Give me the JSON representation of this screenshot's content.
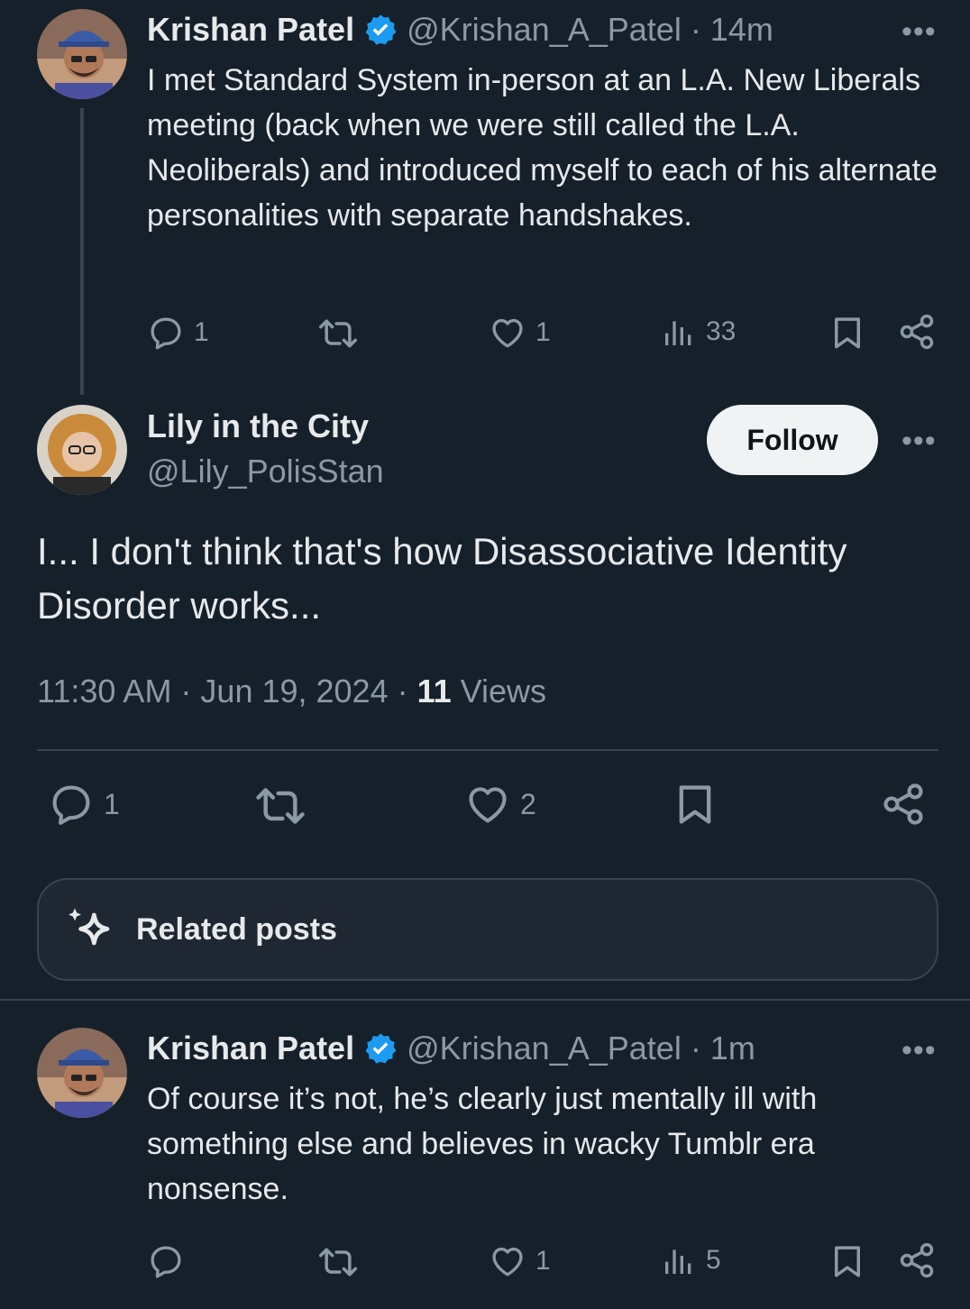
{
  "tweet1": {
    "name": "Krishan Patel",
    "handle": "@Krishan_A_Patel",
    "time": "· 14m",
    "text": "I met Standard System in-person at an L.A. New Liberals meeting (back when we were still called the L.A. Neoliberals) and introduced myself to each of his alternate personalities with separate handshakes.",
    "replies": "1",
    "likes": "1",
    "views": "33"
  },
  "main": {
    "name": "Lily in the City",
    "handle": "@Lily_PolisStan",
    "follow_label": "Follow",
    "text": "I... I don't think that's how Disassociative Identity Disorder works...",
    "timestamp": "11:30 AM · Jun 19, 2024 · ",
    "views_count": "11",
    "views_label": "Views",
    "replies": "1",
    "likes": "2"
  },
  "related": {
    "label": "Related posts"
  },
  "tweet2": {
    "name": "Krishan Patel",
    "handle": "@Krishan_A_Patel",
    "time": "· 1m",
    "text": "Of course it’s not, he’s clearly just mentally ill with something else and believes in wacky Tumblr era nonsense.",
    "likes": "1",
    "views": "5"
  },
  "more_glyph": "•••",
  "colors": {
    "background": "#15202b",
    "verified": "#1d9bf0",
    "muted": "#8b98a5",
    "text": "#e7e9ea"
  },
  "icons": [
    "reply-icon",
    "retweet-icon",
    "like-icon",
    "views-icon",
    "bookmark-icon",
    "share-icon",
    "verified-badge-icon",
    "sparkle-icon"
  ]
}
